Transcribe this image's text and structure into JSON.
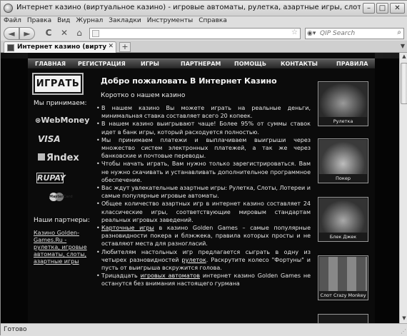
{
  "window": {
    "title": "Интернет казино (виртуальное казино) - игровые автоматы, рулетка, азартные игры, слоты, казино, лотереи, игровые аппараты - Mozilla...",
    "minimize": "–",
    "maximize": "□",
    "close": "✕"
  },
  "menu": [
    "Файл",
    "Правка",
    "Вид",
    "Журнал",
    "Закладки",
    "Инструменты",
    "Справка"
  ],
  "toolbar": {
    "back": "◄",
    "forward": "►",
    "reload": "C",
    "stop": "✕",
    "home": "⌂",
    "address_value": "",
    "search_placeholder": "QIP Search"
  },
  "tabs": {
    "active_label": "Интернет казино (виртуальное казино) - игровые автоматы...",
    "close": "✕",
    "new_tab": "+",
    "list": "▼"
  },
  "site": {
    "nav": [
      "ГЛАВНАЯ",
      "РЕГИСТРАЦИЯ",
      "ИГРЫ",
      "ПАРТНЕРАМ",
      "ПОМОЩЬ",
      "КОНТАКТЫ",
      "ПРАВИЛА"
    ],
    "play_button": "ИГРАТЬ",
    "accept_label": "Мы принимаем:",
    "payments": [
      "WebMoney",
      "VISA",
      "Яndex",
      "RUPAY",
      "MasterCard"
    ],
    "partners_label": "Наши партнеры:",
    "partner_link": "Казино Golden-Games.Ru - рулетка, игровые автоматы, слоты, азартные игры",
    "heading": "Добро пожаловать В Интернет Казино",
    "subheading": "Коротко о нашем казино",
    "bullets": [
      {
        "pre": "В нашем казино Вы можете играть на реальные деньги, минимальная ставка составляет всего 20 копеек.",
        "link": "",
        "post": ""
      },
      {
        "pre": "В нашем казино выигрывают чаще! Более 95% от суммы ставок идет в банк игры, который расходуется полностью.",
        "link": "",
        "post": ""
      },
      {
        "pre": "Мы принимаем платежи и выплачиваем выигрыши через множество систем электронных платежей, а так же через банковские и почтовые переводы.",
        "link": "",
        "post": ""
      },
      {
        "pre": "Чтобы начать играть, Вам нужно только зарегистрироваться. Вам не нужно скачивать и устанавливать дополнительное программное обеспечение.",
        "link": "",
        "post": ""
      },
      {
        "pre": "Вас ждут увлекательные азартные игры: Рулетка, Слоты, Лотереи и самые популярные игровые автоматы.",
        "link": "",
        "post": ""
      },
      {
        "pre": "Общее количество азартных игр в интернет казино составляет 24 классические игры, соответствующие мировым стандартам реальных игровых заведений.",
        "link": "",
        "post": ""
      },
      {
        "pre": "",
        "link": "Карточные игры",
        "post": " в казино Golden Games – самые популярные разновидности покера и блэкжека, правила которых просты и не оставляют места для разногласий."
      },
      {
        "pre": "Любителям настольных игр предлагается сыграть в одну из четырех разновидностей ",
        "link": "рулеток",
        "post": ". Раскрутите колесо \"Фортуны\" и пусть от выигрыша вскружится голова."
      },
      {
        "pre": "Трицадцать ",
        "link": "игровых автоматов",
        "post": " интернет казино Golden Games не останутся без внимания настоящего гурмана"
      }
    ],
    "games": [
      "Рулетка",
      "Покер",
      "Блек Джек",
      "Слот Crazy Monkey"
    ]
  },
  "status": {
    "text": "Готово"
  }
}
